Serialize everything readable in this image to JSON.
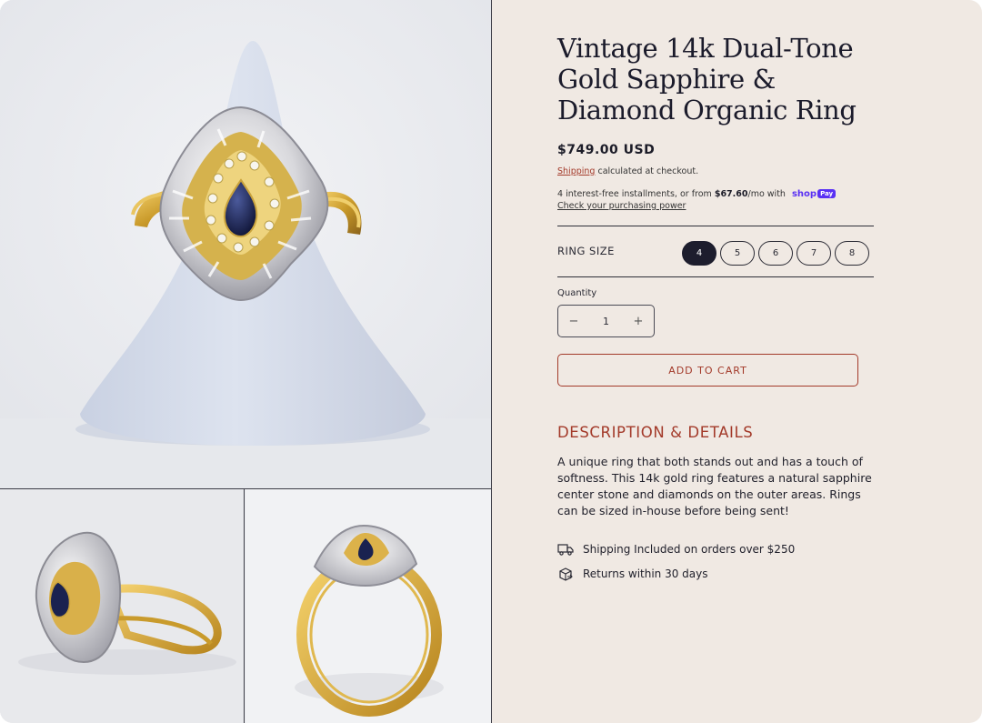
{
  "product": {
    "title": "Vintage 14k Dual-Tone Gold Sapphire & Diamond Organic Ring",
    "price": "$749.00 USD",
    "shipping_link": "Shipping",
    "shipping_note": " calculated at checkout.",
    "installments_prefix": "4 interest-free installments, or from ",
    "installments_amount": "$67.60",
    "installments_suffix": "/mo with",
    "shoppay_brand": "shop",
    "shoppay_pay": "Pay",
    "purchasing_power_link": "Check your purchasing power"
  },
  "ring_size": {
    "label": "RING SIZE",
    "options": [
      "4",
      "5",
      "6",
      "7",
      "8"
    ],
    "selected": "4"
  },
  "quantity": {
    "label": "Quantity",
    "value": "1",
    "minus": "−",
    "plus": "+"
  },
  "cart": {
    "add_label": "ADD TO CART"
  },
  "description": {
    "heading": "DESCRIPTION & DETAILS",
    "body": "A unique ring that both stands out and has a touch of softness. This 14k gold ring features a natural sapphire center stone and diamonds on the outer areas. Rings can be sized in-house before being sent!"
  },
  "perks": [
    {
      "icon": "truck-icon",
      "text": "Shipping Included on orders over $250"
    },
    {
      "icon": "return-box-icon",
      "text": "Returns within 30 days"
    }
  ],
  "colors": {
    "background": "#f0e9e3",
    "accent": "#a33a2a",
    "dark": "#1d1d2d",
    "shoppay": "#5a31f4"
  }
}
